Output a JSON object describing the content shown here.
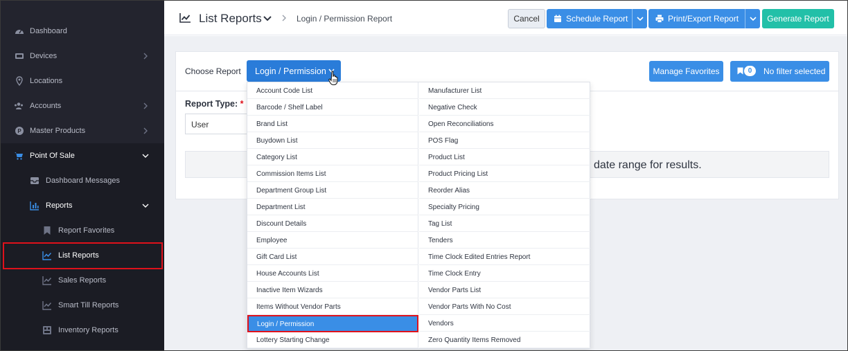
{
  "sidebar": {
    "items": [
      {
        "label": "Dashboard",
        "icon": "dashboard-icon"
      },
      {
        "label": "Devices",
        "icon": "devices-icon"
      },
      {
        "label": "Locations",
        "icon": "location-pin-icon"
      },
      {
        "label": "Accounts",
        "icon": "users-icon"
      },
      {
        "label": "Master Products",
        "icon": "product-tag-icon"
      },
      {
        "label": "Point Of Sale",
        "icon": "cart-icon"
      },
      {
        "label": "Dashboard Messages",
        "icon": "inbox-icon"
      },
      {
        "label": "Reports",
        "icon": "bar-chart-icon"
      },
      {
        "label": "Report Favorites",
        "icon": "bookmark-icon"
      },
      {
        "label": "List Reports",
        "icon": "line-chart-icon"
      },
      {
        "label": "Sales Reports",
        "icon": "line-chart-icon"
      },
      {
        "label": "Smart Till Reports",
        "icon": "line-chart-icon"
      },
      {
        "label": "Inventory Reports",
        "icon": "inventory-icon"
      }
    ]
  },
  "header": {
    "title": "List Reports",
    "breadcrumb": "Login / Permission Report",
    "cancel_label": "Cancel",
    "schedule_label": "Schedule Report",
    "print_label": "Print/Export Report",
    "generate_label": "Generate Report"
  },
  "card": {
    "choose_label": "Choose Report",
    "report_button_label": "Login / Permission",
    "manage_favorites_label": "Manage Favorites",
    "filter_count": "0",
    "filter_label": "No filter selected",
    "report_type_label": "Report Type:",
    "required_mark": "*",
    "report_type_value": "User",
    "info_text": "date range for results."
  },
  "dropdown": {
    "col1": [
      "Account Code List",
      "Barcode / Shelf Label",
      "Brand List",
      "Buydown List",
      "Category List",
      "Commission Items List",
      "Department Group List",
      "Department List",
      "Discount Details",
      "Employee",
      "Gift Card List",
      "House Accounts List",
      "Inactive Item Wizards",
      "Items Without Vendor Parts",
      "Login / Permission",
      "Lottery Starting Change"
    ],
    "col2": [
      "Manufacturer List",
      "Negative Check",
      "Open Reconciliations",
      "POS Flag",
      "Product List",
      "Product Pricing List",
      "Reorder Alias",
      "Specialty Pricing",
      "Tag List",
      "Tenders",
      "Time Clock Edited Entries Report",
      "Time Clock Entry",
      "Vendor Parts List",
      "Vendor Parts With No Cost",
      "Vendors",
      "Zero Quantity Items Removed"
    ],
    "selected": "Login / Permission"
  },
  "colors": {
    "sidebar_bg": "#23242e",
    "accent_blue": "#3a8ee6",
    "generate_green": "#22c0a8",
    "highlight_red": "#e0111b"
  }
}
